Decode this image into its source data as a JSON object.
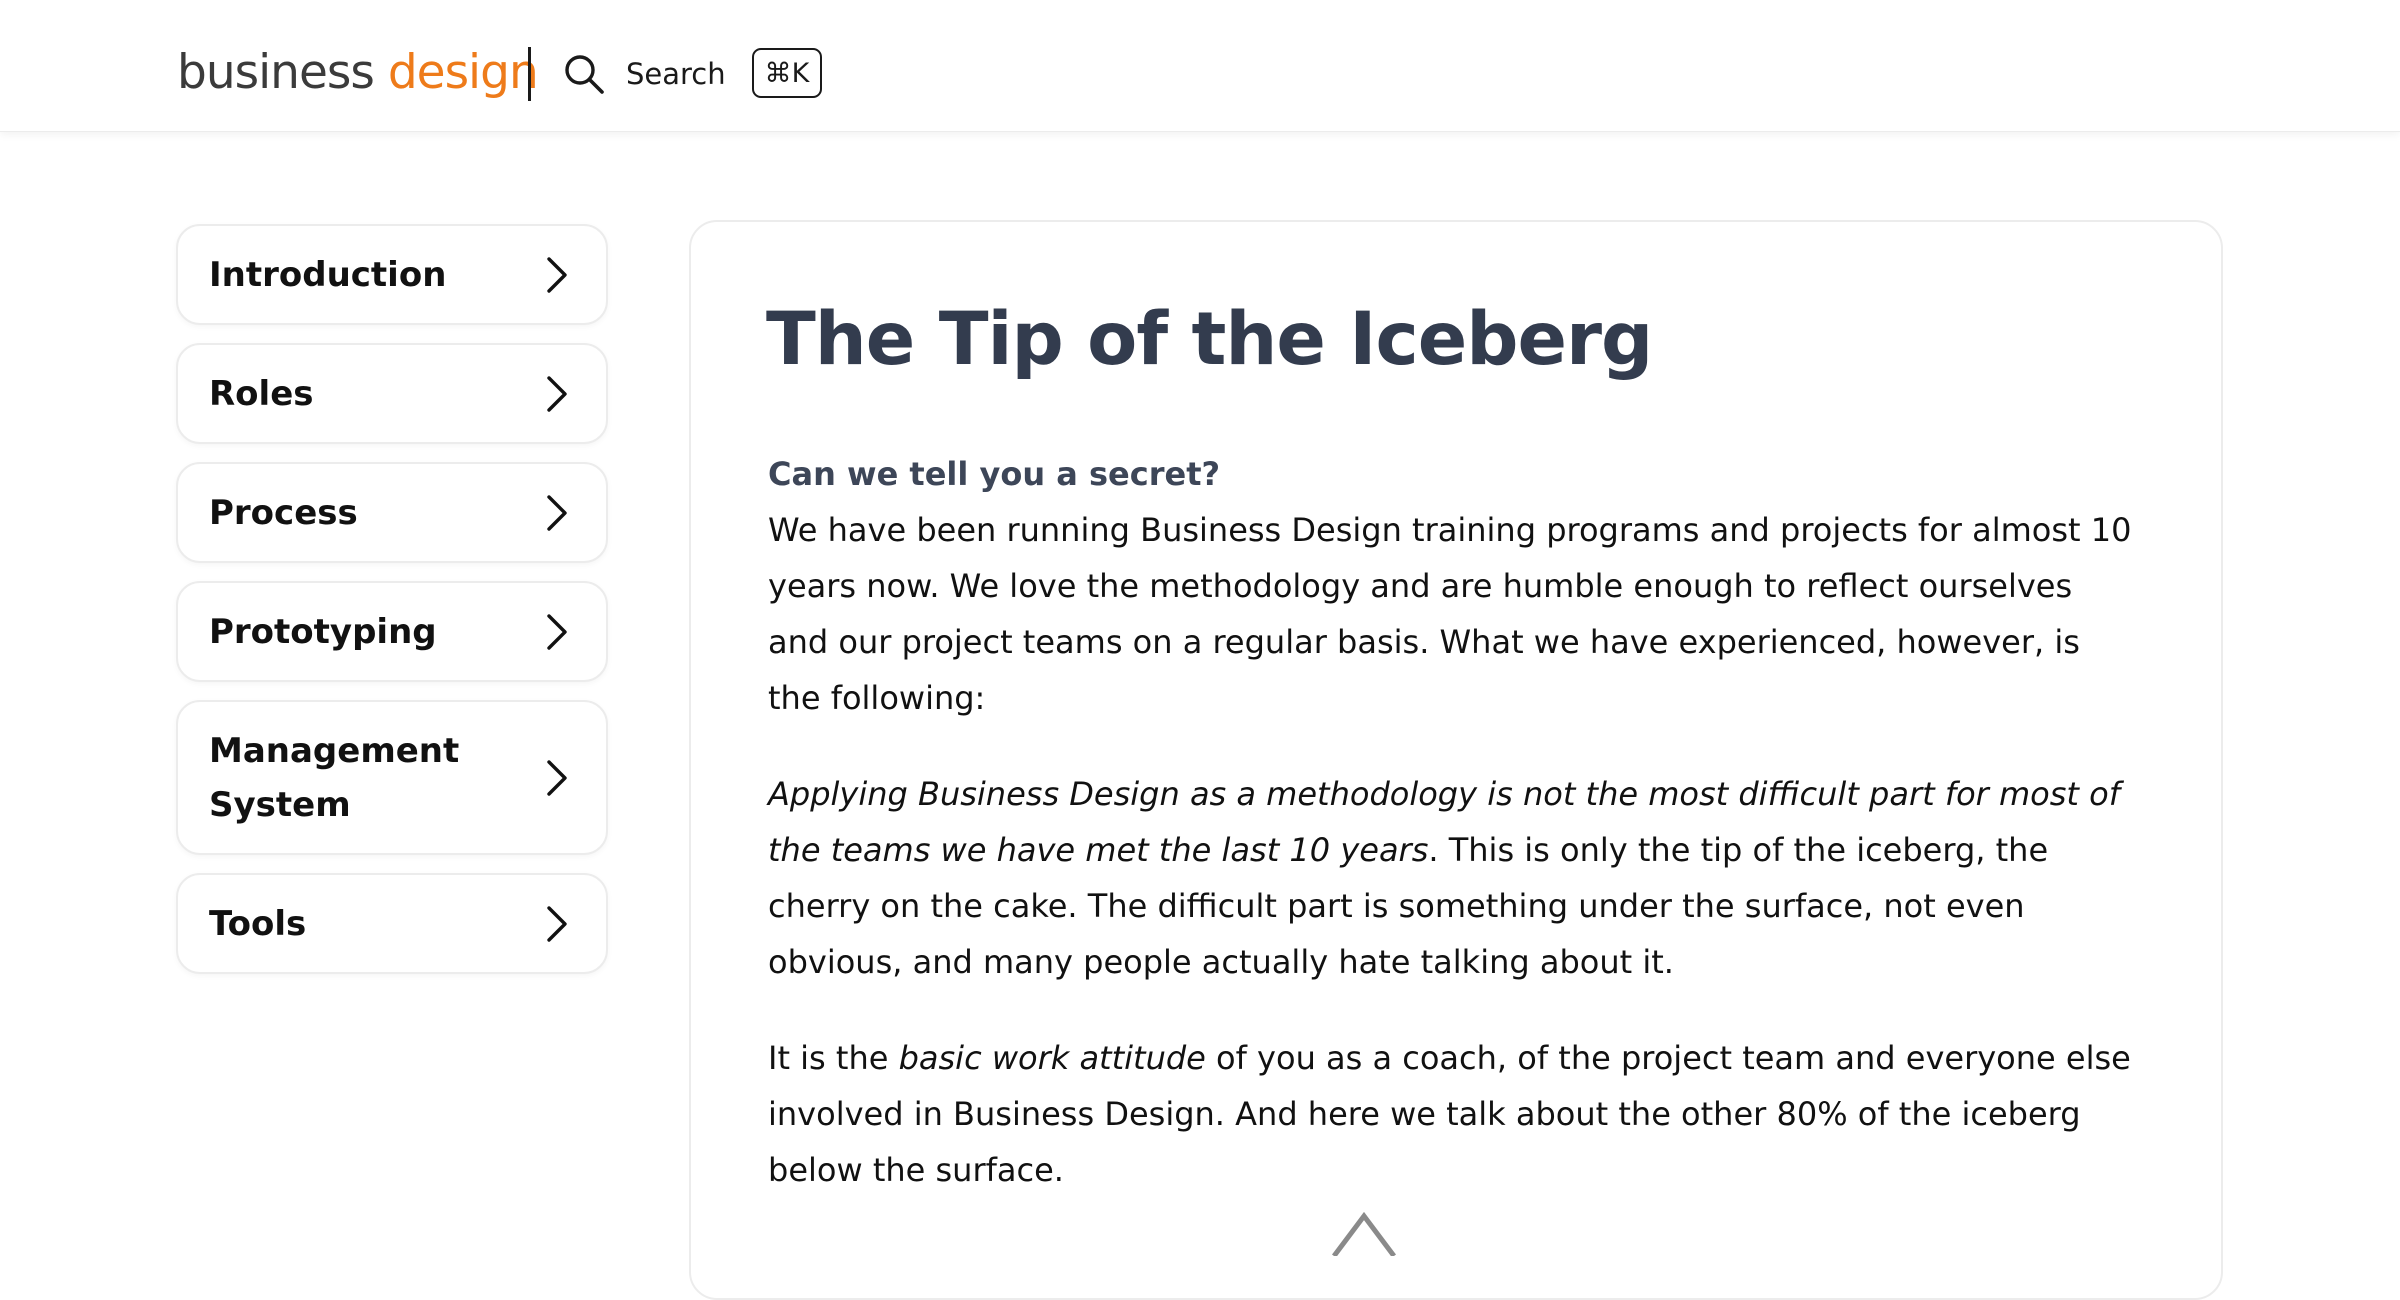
{
  "header": {
    "logo_part1": "business",
    "logo_part2": "design",
    "search_label": "Search",
    "shortcut": "⌘K"
  },
  "sidebar": {
    "items": [
      {
        "label": "Introduction"
      },
      {
        "label": "Roles"
      },
      {
        "label": "Process"
      },
      {
        "label": "Prototyping"
      },
      {
        "label": "Management System"
      },
      {
        "label": "Tools"
      }
    ]
  },
  "article": {
    "title": "The Tip of the Iceberg",
    "lead": "Can we tell you a secret?",
    "p1": "We have been running  Business Design training programs and projects for almost 10 years now. We love the methodology and are humble enough to reflect ourselves and our project teams on a regular basis. What we have experienced, however, is the following:",
    "p2_italic": "Applying Business Design as a methodology is not the most difficult part for most of the teams we have met the last 10 years",
    "p2_rest": ". This is only the tip of the iceberg, the cherry on the cake. The difficult part is something under the surface, not even obvious, and many people actually hate talking about it.",
    "p3_a": "It is the ",
    "p3_italic": "basic work attitude",
    "p3_b": " of you as a coach, of the project team and everyone else involved in Business Design. And here we talk about the other 80% of the iceberg below the surface."
  },
  "colors": {
    "brand_orange": "#ee7b1a",
    "title": "#333c4e",
    "border": "#ececec"
  },
  "icons": {
    "search": "search-icon",
    "chevron": "chevron-right-icon",
    "iceberg": "iceberg-illustration"
  }
}
